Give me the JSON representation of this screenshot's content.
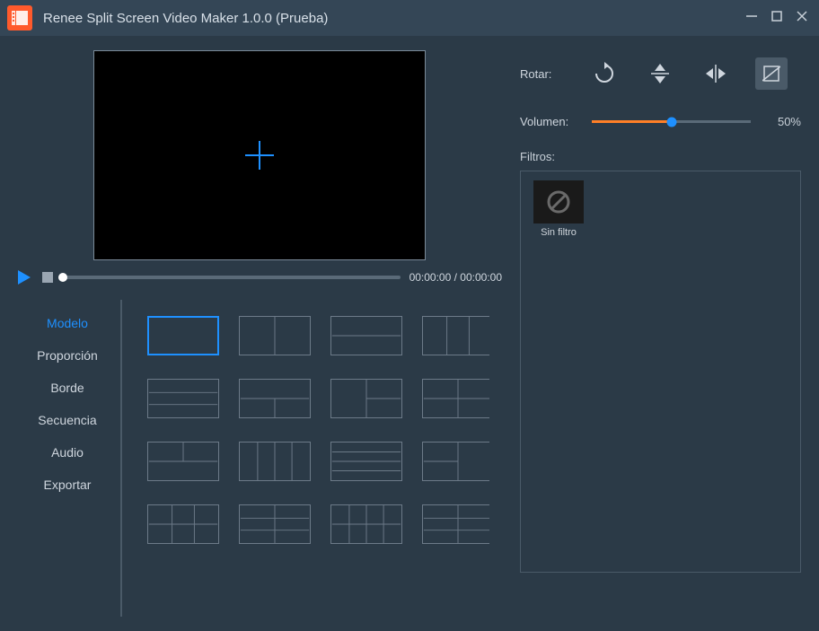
{
  "app": {
    "title": "Renee Split Screen Video Maker 1.0.0 (Prueba)"
  },
  "player": {
    "timecode": "00:00:00 / 00:00:00"
  },
  "sidebar": {
    "items": [
      {
        "label": "Modelo",
        "active": true
      },
      {
        "label": "Proporción",
        "active": false
      },
      {
        "label": "Borde",
        "active": false
      },
      {
        "label": "Secuencia",
        "active": false
      },
      {
        "label": "Audio",
        "active": false
      },
      {
        "label": "Exportar",
        "active": false
      }
    ]
  },
  "controls": {
    "rotate_label": "Rotar:",
    "volume_label": "Volumen:",
    "volume_percent": 50,
    "volume_display": "50%"
  },
  "filters": {
    "label": "Filtros:",
    "items": [
      {
        "name": "Sin filtro"
      }
    ]
  },
  "colors": {
    "accent_blue": "#1e90ff",
    "accent_orange": "#ff7f27"
  }
}
